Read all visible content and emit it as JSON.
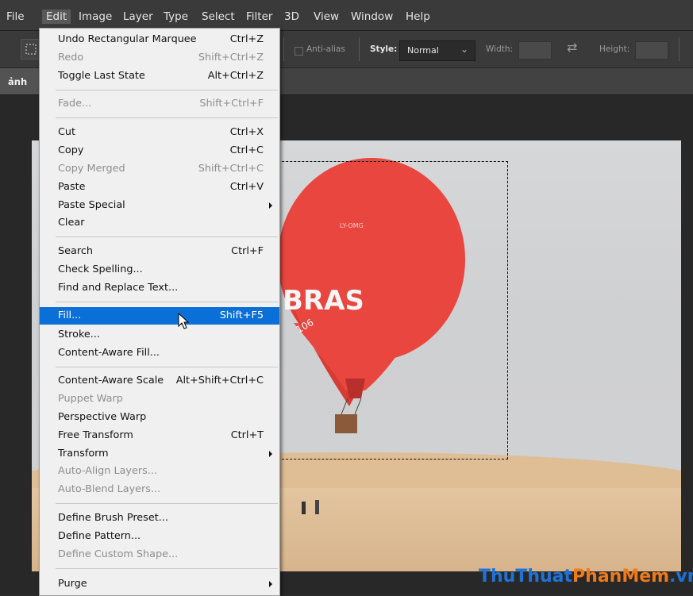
{
  "menubar": {
    "items": [
      "File",
      "Edit",
      "Image",
      "Layer",
      "Type",
      "Select",
      "Filter",
      "3D",
      "View",
      "Window",
      "Help"
    ],
    "active": "Edit"
  },
  "options_bar": {
    "anti_alias_label": "Anti-alias",
    "style_label": "Style:",
    "style_value": "Normal",
    "width_label": "Width:",
    "height_label": "Height:"
  },
  "document": {
    "tab_label": "ảnh"
  },
  "photo": {
    "balloon_text": "BRAS",
    "balloon_small": "LY-OMG",
    "balloon_number": "106"
  },
  "edit_menu": {
    "items": [
      {
        "label": "Undo Rectangular Marquee",
        "shortcut": "Ctrl+Z",
        "disabled": false
      },
      {
        "label": "Redo",
        "shortcut": "Shift+Ctrl+Z",
        "disabled": true
      },
      {
        "label": "Toggle Last State",
        "shortcut": "Alt+Ctrl+Z",
        "disabled": false
      },
      {
        "label": "Fade...",
        "shortcut": "Shift+Ctrl+F",
        "disabled": true
      },
      {
        "label": "Cut",
        "shortcut": "Ctrl+X",
        "disabled": false
      },
      {
        "label": "Copy",
        "shortcut": "Ctrl+C",
        "disabled": false
      },
      {
        "label": "Copy Merged",
        "shortcut": "Shift+Ctrl+C",
        "disabled": true
      },
      {
        "label": "Paste",
        "shortcut": "Ctrl+V",
        "disabled": false
      },
      {
        "label": "Paste Special",
        "shortcut": "",
        "disabled": false,
        "submenu": true
      },
      {
        "label": "Clear",
        "shortcut": "",
        "disabled": false
      },
      {
        "label": "Search",
        "shortcut": "Ctrl+F",
        "disabled": false
      },
      {
        "label": "Check Spelling...",
        "shortcut": "",
        "disabled": false
      },
      {
        "label": "Find and Replace Text...",
        "shortcut": "",
        "disabled": false
      },
      {
        "label": "Fill...",
        "shortcut": "Shift+F5",
        "disabled": false,
        "highlighted": true
      },
      {
        "label": "Stroke...",
        "shortcut": "",
        "disabled": false
      },
      {
        "label": "Content-Aware Fill...",
        "shortcut": "",
        "disabled": false
      },
      {
        "label": "Content-Aware Scale",
        "shortcut": "Alt+Shift+Ctrl+C",
        "disabled": false
      },
      {
        "label": "Puppet Warp",
        "shortcut": "",
        "disabled": true
      },
      {
        "label": "Perspective Warp",
        "shortcut": "",
        "disabled": false
      },
      {
        "label": "Free Transform",
        "shortcut": "Ctrl+T",
        "disabled": false
      },
      {
        "label": "Transform",
        "shortcut": "",
        "disabled": false,
        "submenu": true
      },
      {
        "label": "Auto-Align Layers...",
        "shortcut": "",
        "disabled": true
      },
      {
        "label": "Auto-Blend Layers...",
        "shortcut": "",
        "disabled": true
      },
      {
        "label": "Define Brush Preset...",
        "shortcut": "",
        "disabled": false
      },
      {
        "label": "Define Pattern...",
        "shortcut": "",
        "disabled": false
      },
      {
        "label": "Define Custom Shape...",
        "shortcut": "",
        "disabled": true
      },
      {
        "label": "Purge",
        "shortcut": "",
        "disabled": false,
        "submenu": true
      }
    ]
  },
  "watermark": {
    "part1": "ThuThuat",
    "part2": "PhanMem",
    "part3": ".vn"
  },
  "colors": {
    "highlight": "#0a6fd6",
    "menu_bg": "#f0f0f0",
    "app_bg": "#2b2b2b",
    "balloon": "#e8463e"
  }
}
